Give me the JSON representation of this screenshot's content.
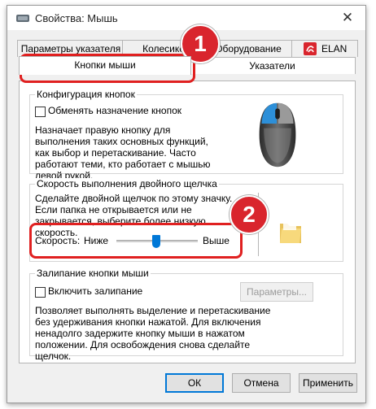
{
  "window": {
    "title": "Свойства: Мышь",
    "close_glyph": "✕"
  },
  "tabs": {
    "back_row": [
      "Параметры указателя",
      "Колесико",
      "Оборудование",
      "ELAN"
    ],
    "front_row": [
      "Кнопки мыши",
      "Указатели"
    ],
    "selected": "Кнопки мыши",
    "elan_icon_color": "#d9252d"
  },
  "button_config": {
    "title": "Конфигурация кнопок",
    "swap_label": "Обменять назначение кнопок",
    "swap_checked": false,
    "description": "Назначает правую кнопку для выполнения таких основных функций, как выбор и перетаскивание. Часто работают теми, кто работает с мышью левой рукой."
  },
  "double_click": {
    "title": "Скорость выполнения двойного щелчка",
    "description_lines": [
      "Сделайте двойной щелчок по этому значку.",
      "Если папка не открывается или не",
      "закрывается, выберите более низкую скорость."
    ],
    "speed_label": "Скорость:",
    "low_label": "Ниже",
    "high_label": "Выше",
    "speed_value": 0.5
  },
  "click_lock": {
    "title": "Залипание кнопки мыши",
    "enable_label": "Включить залипание",
    "enable_checked": false,
    "settings_button": "Параметры...",
    "description": "Позволяет выполнять выделение и перетаскивание без удерживания кнопки нажатой. Для включения ненадолго задержите кнопку мыши в нажатом положении. Для освобождения снова сделайте щелчок."
  },
  "footer": {
    "ok": "ОК",
    "cancel": "Отмена",
    "apply": "Применить"
  },
  "annotations": {
    "badge_1": "1",
    "badge_2": "2",
    "highlight_color": "#e02020"
  },
  "icons": {
    "mouse": "mouse-illustration-icon",
    "folder": "folder-icon",
    "elan": "elan-icon"
  }
}
